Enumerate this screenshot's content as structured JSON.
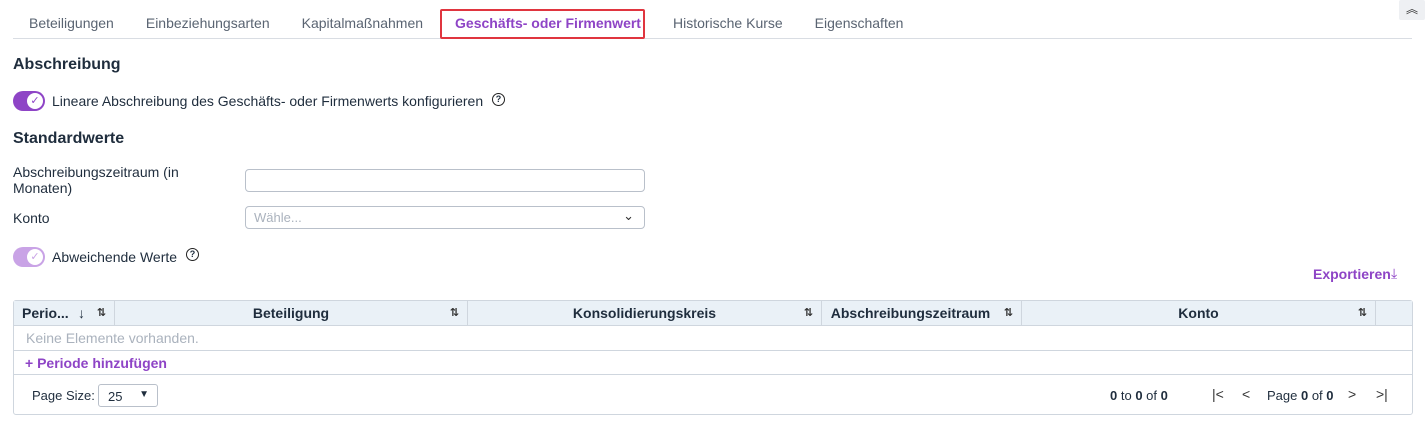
{
  "tabs": [
    {
      "label": "Beteiligungen"
    },
    {
      "label": "Einbeziehungsarten"
    },
    {
      "label": "Kapitalmaßnahmen"
    },
    {
      "label": "Geschäfts- oder Firmenwert"
    },
    {
      "label": "Historische Kurse"
    },
    {
      "label": "Eigenschaften"
    }
  ],
  "active_tab": "Geschäfts- oder Firmenwert",
  "collapse_icon": "double-chevron-up",
  "section_abschreibung": {
    "title": "Abschreibung"
  },
  "toggle_linear": {
    "label": "Lineare Abschreibung des Geschäfts- oder Firmenwerts konfigurieren",
    "checked": true
  },
  "section_standard": {
    "title": "Standardwerte"
  },
  "field_zeitraum": {
    "label_line1": "Abschreibungszeitraum (in",
    "label_line2": "Monaten)",
    "value": ""
  },
  "field_konto": {
    "label": "Konto",
    "placeholder": "Wähle..."
  },
  "toggle_abweichend": {
    "label": "Abweichende Werte",
    "checked": true,
    "disabled": true
  },
  "export": {
    "label": "Exportieren"
  },
  "grid": {
    "columns": [
      "Perio...",
      "Beteiligung",
      "Konsolidierungskreis",
      "Abschreibungszeitraum",
      "Konto"
    ],
    "empty_text": "Keine Elemente vorhanden.",
    "add_label": "Periode hinzufügen",
    "page_size_label": "Page Size:",
    "page_size": "25",
    "range_from": "0",
    "range_to": "0",
    "range_total": "0",
    "page_current": "0",
    "page_total": "0"
  },
  "colors": {
    "accent": "#8e44c6",
    "highlight": "#e0353f"
  }
}
